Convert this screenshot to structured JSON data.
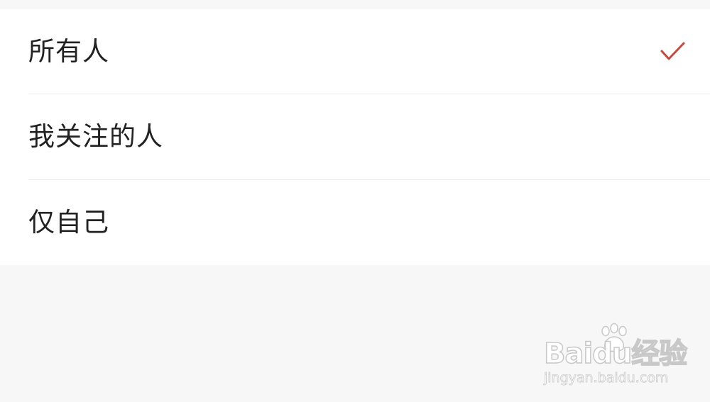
{
  "visibility_options": [
    {
      "label": "所有人",
      "selected": true
    },
    {
      "label": "我关注的人",
      "selected": false
    },
    {
      "label": "仅自己",
      "selected": false
    }
  ],
  "selected_icon": "checkmark-icon",
  "colors": {
    "accent": "#c9473c",
    "text": "#222222",
    "divider": "#ebebeb",
    "page_background": "#f7f7f7",
    "list_background": "#ffffff"
  },
  "watermark": {
    "brand": "Baidu经验",
    "url": "jingyan.baidu.com",
    "icon": "paw-icon"
  }
}
